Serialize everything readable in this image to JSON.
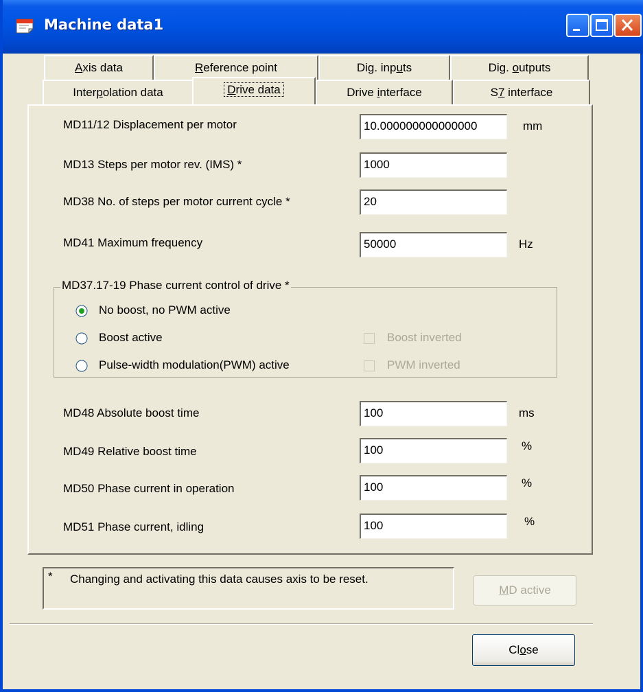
{
  "window": {
    "title": "Machine data1",
    "icons": {
      "app": "machine-data-icon",
      "minimize": "minimize-icon",
      "maximize": "maximize-icon",
      "close": "close-icon"
    }
  },
  "tabs": {
    "back_row": [
      {
        "label": "Axis data",
        "mnemonic": "A"
      },
      {
        "label": "Reference point",
        "mnemonic": "R"
      },
      {
        "label": "Dig. inputs",
        "mnemonic": "u"
      },
      {
        "label": "Dig. outputs",
        "mnemonic": "o"
      }
    ],
    "front_row": [
      {
        "label": "Interpolation data",
        "mnemonic": "p"
      },
      {
        "label": "Drive data",
        "mnemonic": "D",
        "selected": true
      },
      {
        "label": "Drive interface",
        "mnemonic": "i"
      },
      {
        "label": "S7 interface",
        "mnemonic": "7"
      }
    ]
  },
  "drive": {
    "fields": [
      {
        "label": "MD11/12 Displacement per motor",
        "value": "10.000000000000000",
        "unit": "mm"
      },
      {
        "label": "MD13 Steps per motor rev. (IMS) *",
        "value": "1000",
        "unit": ""
      },
      {
        "label": "MD38 No. of steps per motor current cycle *",
        "value": "20",
        "unit": ""
      },
      {
        "label": "MD41 Maximum frequency",
        "value": "50000",
        "unit": "Hz"
      }
    ],
    "phase_group": {
      "title": "MD37.17-19 Phase current control of drive *",
      "options": [
        {
          "label": "No boost, no PWM active",
          "checked": true
        },
        {
          "label": "Boost active",
          "checked": false
        },
        {
          "label": "Pulse-width modulation(PWM) active",
          "checked": false
        }
      ],
      "checkboxes": [
        {
          "label": "Boost inverted",
          "checked": false,
          "enabled": false
        },
        {
          "label": "PWM inverted",
          "checked": false,
          "enabled": false
        }
      ]
    },
    "boost_fields": [
      {
        "label": "MD48 Absolute boost time",
        "value": "100",
        "unit": "ms"
      },
      {
        "label": "MD49 Relative boost time",
        "value": "100",
        "unit": "%"
      },
      {
        "label": "MD50 Phase current in operation",
        "value": "100",
        "unit": "%"
      },
      {
        "label": "MD51 Phase current, idling",
        "value": "100",
        "unit": "%"
      }
    ]
  },
  "footer": {
    "note_marker": "*",
    "note_text": "Changing and activating this data causes axis to be reset.",
    "md_active_label": "MD active",
    "close_label": "Close"
  },
  "colors": {
    "titlebar": "#0054e3",
    "dialog_bg": "#ece9d8",
    "close_button": "#d7461c",
    "disabled_text": "#aca899"
  }
}
